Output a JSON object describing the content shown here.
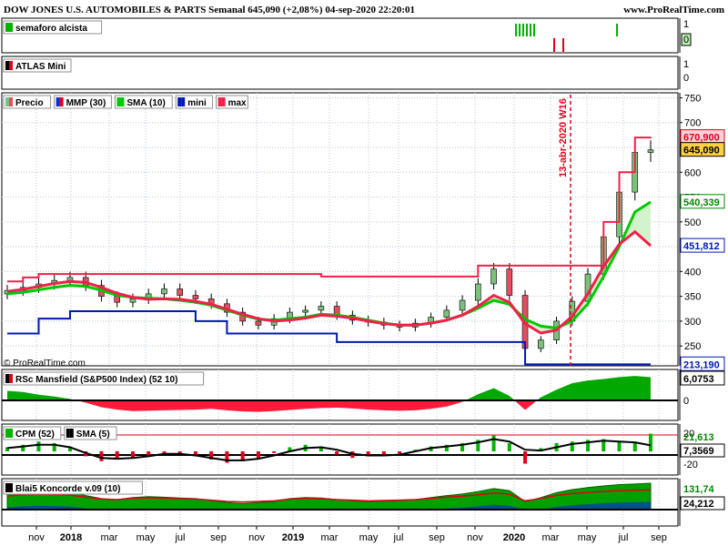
{
  "header": {
    "title": "DOW JONES U.S. AUTOMOBILES & PARTS Semanal 645,090 (+2,08%) 04-sep-2020 22:20:01",
    "site": "www.ProRealTime.com"
  },
  "footer": {
    "copyright": "© ProRealTime.com"
  },
  "colors": {
    "up": "#00b400",
    "down": "#e0001a",
    "ema": "#00c800",
    "sma": "#f0204a",
    "mini": "#0018b4",
    "max": "#f0204a",
    "mansfield_pos": "#00a800",
    "mansfield_neg": "#ff1a3a",
    "grid": "#b4c8d8",
    "bg": "#ffffff"
  },
  "panels": [
    {
      "id": "semaforo",
      "legend": [
        "semaforo alcista"
      ],
      "ticks": [
        "1",
        "0"
      ],
      "badge": "0"
    },
    {
      "id": "atlas",
      "legend": [
        "ATLAS Mini"
      ],
      "ticks": [
        "1",
        "0"
      ]
    },
    {
      "id": "price",
      "legend": [
        "Precio",
        "MMP (30)",
        "SMA (10)",
        "mini",
        "max"
      ],
      "ticks": [
        "750",
        "700",
        "650",
        "600",
        "550",
        "500",
        "450",
        "400",
        "350",
        "300",
        "250"
      ],
      "badges": [
        "670,900",
        "645,090",
        "540,339",
        "451,812",
        "213,190"
      ],
      "annotation": "13-abr-2020 W16"
    },
    {
      "id": "mansfield",
      "legend": [
        "RSc Mansfield (S&P500 Index) (52 10)"
      ],
      "ticks": [
        "0"
      ],
      "badges": [
        "6,0753"
      ]
    },
    {
      "id": "cpm",
      "legend": [
        "CPM (52)",
        "SMA (5)"
      ],
      "ticks": [
        "20",
        "-20"
      ],
      "badges": [
        "21,613",
        "7,3569"
      ]
    },
    {
      "id": "konc",
      "legend": [
        "Blai5 Koncorde v.09 (10)"
      ],
      "badges": [
        "131,74",
        "24,212"
      ]
    }
  ],
  "chart_data": {
    "type": "line",
    "title": "DOW JONES U.S. AUTOMOBILES & PARTS Semanal 645,090 (+2,08%) 04-sep-2020 22:20:01",
    "x_ticks": [
      "nov",
      "2018",
      "mar",
      "may",
      "jul",
      "sep",
      "nov",
      "2019",
      "mar",
      "may",
      "jul",
      "sep",
      "nov",
      "2020",
      "mar",
      "may",
      "jul",
      "sep"
    ],
    "ylim": [
      210,
      760
    ],
    "x": [
      "2017-10-06",
      "2017-11-03",
      "2017-12-01",
      "2017-12-29",
      "2018-01-26",
      "2018-02-23",
      "2018-03-23",
      "2018-04-20",
      "2018-05-18",
      "2018-06-15",
      "2018-07-13",
      "2018-08-10",
      "2018-09-07",
      "2018-10-05",
      "2018-11-02",
      "2018-11-30",
      "2018-12-28",
      "2019-01-25",
      "2019-02-22",
      "2019-03-22",
      "2019-04-19",
      "2019-05-17",
      "2019-06-14",
      "2019-07-12",
      "2019-08-09",
      "2019-09-06",
      "2019-10-04",
      "2019-11-01",
      "2019-11-29",
      "2019-12-27",
      "2020-01-24",
      "2020-02-21",
      "2020-03-06",
      "2020-03-20",
      "2020-04-03",
      "2020-04-17",
      "2020-05-15",
      "2020-06-12",
      "2020-07-10",
      "2020-08-07",
      "2020-08-21",
      "2020-09-04"
    ],
    "series": [
      {
        "name": "Precio",
        "values": [
          362,
          368,
          375,
          382,
          388,
          372,
          350,
          338,
          345,
          355,
          365,
          352,
          345,
          335,
          318,
          300,
          292,
          305,
          318,
          322,
          330,
          312,
          302,
          298,
          292,
          288,
          296,
          308,
          322,
          342,
          375,
          405,
          352,
          245,
          262,
          300,
          340,
          395,
          470,
          560,
          640,
          645
        ]
      },
      {
        "name": "MMP (30)",
        "values": [
          355,
          358,
          363,
          368,
          372,
          370,
          362,
          352,
          348,
          346,
          345,
          342,
          338,
          332,
          322,
          312,
          304,
          302,
          305,
          308,
          314,
          312,
          308,
          302,
          296,
          292,
          292,
          296,
          302,
          312,
          326,
          342,
          334,
          304,
          290,
          286,
          300,
          335,
          390,
          450,
          520,
          540
        ]
      },
      {
        "name": "SMA (10)",
        "values": [
          360,
          364,
          370,
          376,
          380,
          378,
          368,
          356,
          348,
          344,
          345,
          344,
          340,
          334,
          324,
          314,
          305,
          300,
          302,
          306,
          312,
          310,
          306,
          300,
          295,
          292,
          292,
          296,
          302,
          312,
          330,
          352,
          338,
          295,
          276,
          282,
          310,
          355,
          410,
          455,
          480,
          452
        ]
      },
      {
        "name": "mini",
        "values": [
          275,
          275,
          305,
          305,
          320,
          320,
          320,
          320,
          320,
          320,
          320,
          320,
          300,
          300,
          275,
          275,
          275,
          275,
          275,
          275,
          275,
          258,
          258,
          258,
          258,
          258,
          258,
          258,
          258,
          258,
          258,
          258,
          258,
          213,
          213,
          213,
          213,
          213,
          213,
          213,
          213,
          213
        ]
      },
      {
        "name": "max",
        "values": [
          380,
          388,
          395,
          395,
          395,
          395,
          395,
          395,
          395,
          395,
          395,
          395,
          395,
          395,
          395,
          395,
          395,
          395,
          395,
          395,
          390,
          390,
          390,
          390,
          390,
          390,
          390,
          390,
          390,
          390,
          412,
          412,
          412,
          412,
          412,
          412,
          412,
          412,
          500,
          600,
          670,
          671
        ]
      },
      {
        "name": "RSc Mansfield (S&P500 Index) (52 10)",
        "values": [
          2.5,
          2.2,
          1.5,
          1.0,
          0.4,
          -0.6,
          -1.8,
          -2.4,
          -2.8,
          -2.7,
          -2.6,
          -2.5,
          -2.4,
          -2.2,
          -2.6,
          -2.9,
          -3.0,
          -2.8,
          -2.5,
          -2.2,
          -2.0,
          -1.9,
          -2.1,
          -2.4,
          -2.6,
          -2.7,
          -2.6,
          -2.2,
          -1.6,
          -0.4,
          1.6,
          3.2,
          1.2,
          -2.5,
          0.8,
          2.8,
          4.5,
          5.2,
          5.6,
          6.1,
          6.4,
          6.0753
        ]
      },
      {
        "name": "CPM (52)",
        "values": [
          5,
          8,
          12,
          10,
          4,
          -6,
          -12,
          -10,
          -8,
          -5,
          -2,
          -4,
          -6,
          -10,
          -14,
          -12,
          -8,
          -2,
          5,
          8,
          6,
          -4,
          -8,
          -6,
          -5,
          -3,
          2,
          6,
          8,
          10,
          14,
          20,
          10,
          -15,
          4,
          10,
          12,
          14,
          15,
          12,
          10,
          21.613
        ]
      },
      {
        "name": "SMA (5)",
        "values": [
          4,
          6,
          8,
          8,
          5,
          -2,
          -8,
          -9,
          -8,
          -6,
          -3,
          -3,
          -5,
          -8,
          -11,
          -11,
          -9,
          -5,
          0,
          4,
          5,
          2,
          -3,
          -5,
          -5,
          -4,
          0,
          4,
          6,
          8,
          11,
          15,
          12,
          2,
          1,
          5,
          9,
          11,
          13,
          12,
          11,
          7.3569
        ]
      },
      {
        "name": "Blai5 Koncorde v.09 (10)",
        "values": [
          80,
          90,
          95,
          92,
          88,
          70,
          55,
          50,
          60,
          65,
          62,
          58,
          55,
          45,
          35,
          30,
          35,
          40,
          55,
          60,
          58,
          50,
          45,
          40,
          42,
          45,
          50,
          60,
          70,
          78,
          90,
          105,
          95,
          40,
          60,
          85,
          100,
          110,
          118,
          125,
          128,
          131.74
        ]
      }
    ]
  }
}
